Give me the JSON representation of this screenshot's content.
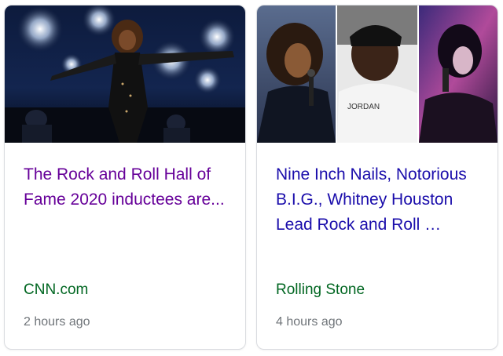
{
  "cards": [
    {
      "headline": "The Rock and Roll Hall of Fame 2020 inductees are...",
      "source": "CNN.com",
      "time": "2 hours ago",
      "link_color": "#660099"
    },
    {
      "headline": "Nine Inch Nails, Notorious B.I.G., Whitney Houston Lead Rock and Roll …",
      "source": "Rolling Stone",
      "time": "4 hours ago",
      "link_color": "#1a0dab"
    }
  ],
  "colors": {
    "source": "#006621",
    "time": "#70757a",
    "border": "#dadce0"
  },
  "images": {
    "card1_photo_text": "JORDAN"
  }
}
